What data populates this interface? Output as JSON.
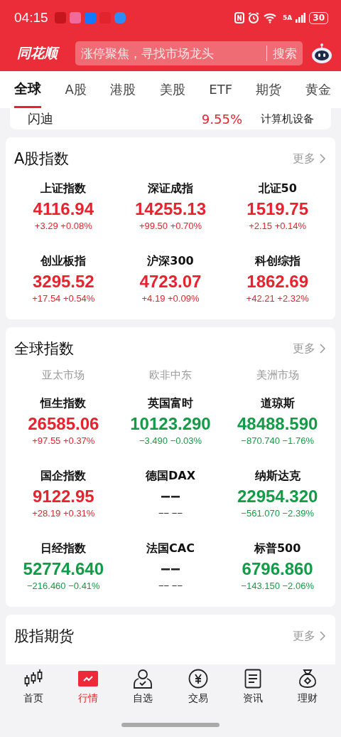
{
  "status_bar": {
    "time": "04:15",
    "network": "5A",
    "battery": "30"
  },
  "header": {
    "logo": "同花顺",
    "search_placeholder": "涨停聚焦，寻找市场龙头",
    "search_button": "搜索"
  },
  "tabs": [
    {
      "label": "全球",
      "selected": true
    },
    {
      "label": "A股",
      "selected": false
    },
    {
      "label": "港股",
      "selected": false
    },
    {
      "label": "美股",
      "selected": false
    },
    {
      "label": "ETF",
      "selected": false
    },
    {
      "label": "期货",
      "selected": false
    },
    {
      "label": "黄金",
      "selected": false
    }
  ],
  "stock_row": {
    "name": "闪迪",
    "change": "9.55%",
    "sector": "计算机设备"
  },
  "a_share_indices": {
    "title": "A股指数",
    "more": "更多",
    "items": [
      {
        "name": "上证指数",
        "value": "4116.94",
        "change": "+3.29 +0.08%",
        "color": "#e8232f"
      },
      {
        "name": "深证成指",
        "value": "14255.13",
        "change": "+99.50 +0.70%",
        "color": "#e8232f"
      },
      {
        "name": "北证50",
        "value": "1519.75",
        "change": "+2.15 +0.14%",
        "color": "#e8232f"
      },
      {
        "name": "创业板指",
        "value": "3295.52",
        "change": "+17.54 +0.54%",
        "color": "#e8232f"
      },
      {
        "name": "沪深300",
        "value": "4723.07",
        "change": "+4.19 +0.09%",
        "color": "#e8232f"
      },
      {
        "name": "科创综指",
        "value": "1862.69",
        "change": "+42.21 +2.32%",
        "color": "#e8232f"
      }
    ]
  },
  "global_indices": {
    "title": "全球指数",
    "more": "更多",
    "regions": [
      "亚太市场",
      "欧非中东",
      "美洲市场"
    ],
    "items": [
      {
        "name": "恒生指数",
        "value": "26585.06",
        "change": "+97.55 +0.37%",
        "color": "#e8232f"
      },
      {
        "name": "英国富时",
        "value": "10123.290",
        "change": "−3.490 −0.03%",
        "color": "#129c47"
      },
      {
        "name": "道琼斯",
        "value": "48488.590",
        "change": "−870.740 −1.76%",
        "color": "#129c47"
      },
      {
        "name": "国企指数",
        "value": "9122.95",
        "change": "+28.19 +0.31%",
        "color": "#e8232f"
      },
      {
        "name": "德国DAX",
        "value": "−−",
        "change": "−− −−",
        "color": "#222222"
      },
      {
        "name": "纳斯达克",
        "value": "22954.320",
        "change": "−561.070 −2.39%",
        "color": "#129c47"
      },
      {
        "name": "日经指数",
        "value": "52774.640",
        "change": "−216.460 −0.41%",
        "color": "#129c47"
      },
      {
        "name": "法国CAC",
        "value": "−−",
        "change": "−− −−",
        "color": "#222222"
      },
      {
        "name": "标普500",
        "value": "6796.860",
        "change": "−143.150 −2.06%",
        "color": "#129c47"
      }
    ]
  },
  "futures": {
    "title": "股指期货",
    "more": "更多"
  },
  "bottom_nav": [
    {
      "label": "首页",
      "kind": "candles",
      "selected": false
    },
    {
      "label": "行情",
      "kind": "chart",
      "selected": true
    },
    {
      "label": "自选",
      "kind": "person",
      "selected": false
    },
    {
      "label": "交易",
      "kind": "yen",
      "selected": false
    },
    {
      "label": "资讯",
      "kind": "doc",
      "selected": false
    },
    {
      "label": "理财",
      "kind": "bag",
      "selected": false
    }
  ]
}
